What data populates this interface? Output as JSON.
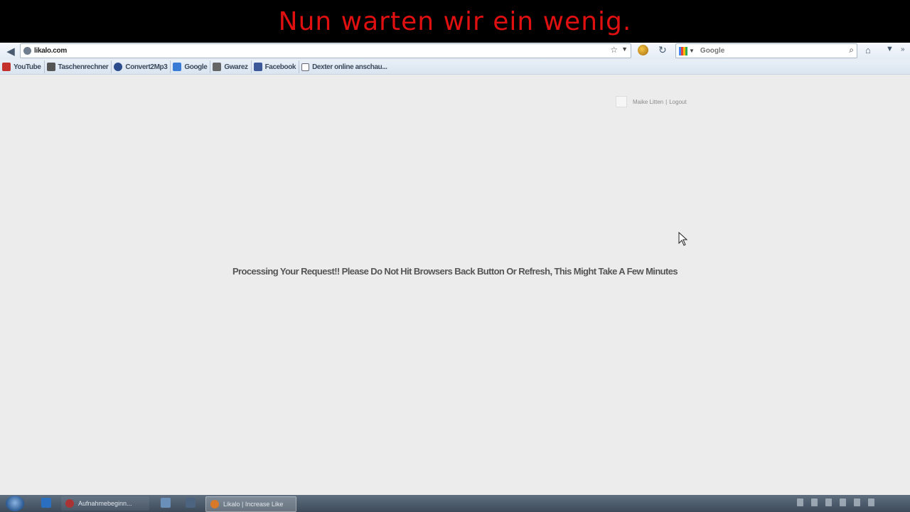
{
  "caption": "Nun warten wir ein wenig.",
  "browser": {
    "url": "likalo.com",
    "search_placeholder": "Google",
    "bookmarks": [
      {
        "label": "YouTube",
        "icon": "youtube-icon",
        "color": "#c4302b"
      },
      {
        "label": "Taschenrechner",
        "icon": "calculator-icon",
        "color": "#555555"
      },
      {
        "label": "Convert2Mp3",
        "icon": "convert2mp3-icon",
        "color": "#2b4c8c"
      },
      {
        "label": "Google",
        "icon": "google-icon",
        "color": "#3a7bd5"
      },
      {
        "label": "Gwarez",
        "icon": "gwarez-icon",
        "color": "#666666"
      },
      {
        "label": "Facebook",
        "icon": "facebook-icon",
        "color": "#3b5998"
      },
      {
        "label": "Dexter online anschau...",
        "icon": "page-icon",
        "color": "#ffffff"
      }
    ]
  },
  "page": {
    "user_name": "Maike Litten",
    "separator": "|",
    "logout": "Logout",
    "message": "Processing Your Request!! Please Do Not Hit Browsers Back Button Or Refresh, This Might Take A Few Minutes"
  },
  "taskbar": {
    "tasks": [
      {
        "label": "Aufnahmebeginn...",
        "active": false
      },
      {
        "label": "Likalo | Increase Like",
        "active": true
      }
    ]
  },
  "colors": {
    "caption_text": "#e01010",
    "page_background": "#ececec"
  }
}
